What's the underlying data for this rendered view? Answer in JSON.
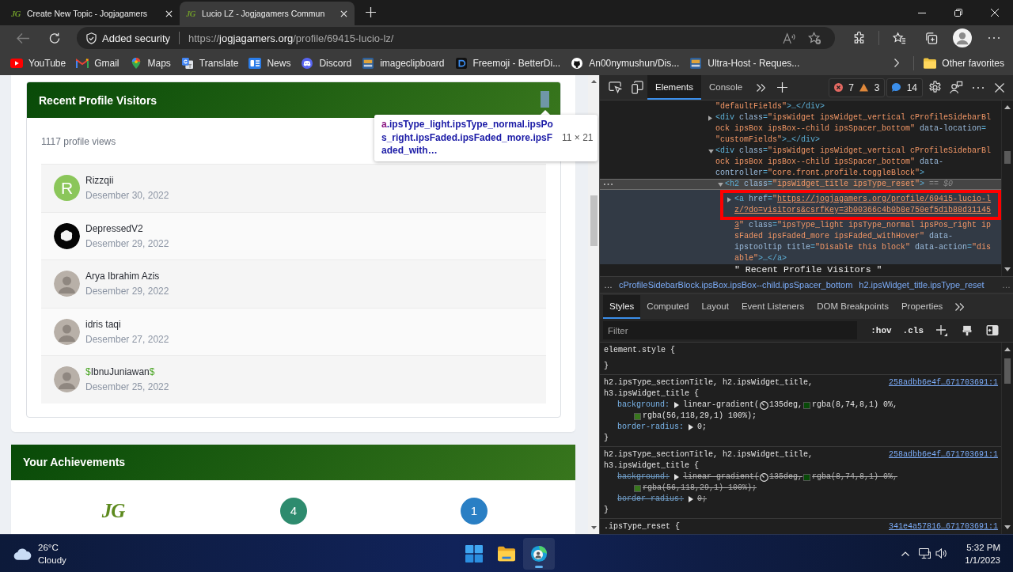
{
  "browser": {
    "tabs": [
      {
        "logo": "JG",
        "title": "Create New Topic - Jogjagamers",
        "selected": false
      },
      {
        "logo": "JG",
        "title": "Lucio LZ - Jogjagamers Commun",
        "selected": true
      }
    ],
    "back_button": {
      "disabled": true
    },
    "address_bar": {
      "security_label": "Added security",
      "url_scheme": "https://",
      "url_host": "jogjagamers.org",
      "url_path": "/profile/69415-lucio-lz/"
    },
    "bookmarks": [
      {
        "kind": "youtube",
        "label": "YouTube"
      },
      {
        "kind": "gmail",
        "label": "Gmail"
      },
      {
        "kind": "maps",
        "label": "Maps"
      },
      {
        "kind": "translate",
        "label": "Translate"
      },
      {
        "kind": "news",
        "label": "News"
      },
      {
        "kind": "discord",
        "label": "Discord"
      },
      {
        "kind": "picture",
        "label": "imageclipboard"
      },
      {
        "kind": "freemoji",
        "label": "Freemoji - BetterDi..."
      },
      {
        "kind": "github",
        "label": "An00nymushun/Dis..."
      },
      {
        "kind": "picture",
        "label": "Ultra-Host - Reques..."
      }
    ],
    "other_favorites": "Other favorites"
  },
  "page": {
    "visitors_widget": {
      "title": "Recent Profile Visitors",
      "view_count": "1117 profile views",
      "visitors": [
        {
          "kind": "letter",
          "initial": "R",
          "name": "Rizzqii",
          "date": "Desember 30, 2022"
        },
        {
          "kind": "graphic",
          "name": "DepressedV2",
          "date": "Desember 29, 2022"
        },
        {
          "kind": "photo",
          "name": "Arya Ibrahim Azis",
          "date": "Desember 29, 2022"
        },
        {
          "kind": "photo",
          "name": "idris taqi",
          "date": "Desember 27, 2022"
        },
        {
          "kind": "photo",
          "name_parts": [
            {
              "text": "$",
              "accent": true
            },
            {
              "text": "IbnuJuniawan",
              "accent": false
            },
            {
              "text": "$",
              "accent": true
            }
          ],
          "date": "Desember 25, 2022"
        }
      ]
    },
    "inspect_tooltip": {
      "element": "a",
      "classes": ".ipsType_light.ipsType_normal.ipsPos_right.ipsFaded.ipsFaded_more.ipsFaded_with…",
      "size": "11 × 21"
    },
    "achievements_widget": {
      "title": "Your Achievements",
      "items": [
        {
          "kind": "logo",
          "text": "JG"
        },
        {
          "kind": "badge",
          "text": "4",
          "color": "#2e8b6e"
        },
        {
          "kind": "badge",
          "text": "1",
          "color": "#2a7fc4"
        }
      ]
    }
  },
  "devtools": {
    "tabs": [
      {
        "label": "Elements",
        "selected": true
      },
      {
        "label": "Console",
        "selected": false
      }
    ],
    "issues": {
      "errors": "7",
      "warnings": "3",
      "messages": "14"
    },
    "dom_tree": [
      {
        "selected": false,
        "hovered": false,
        "lines": [
          {
            "tokens": [
              {
                "kind": "value",
                "text": "\"defaultFields\""
              },
              {
                "kind": "tag",
                "text": ">…</div>"
              }
            ]
          }
        ]
      },
      {
        "expanded": false,
        "selected": false,
        "hovered": false,
        "lines": [
          {
            "tokens": [
              {
                "kind": "tag",
                "text": "<div"
              },
              {
                "kind": "attr",
                "text": " class"
              },
              {
                "kind": "tag",
                "text": "="
              },
              {
                "kind": "value",
                "text": "\"ipsWidget ipsWidget_vertical cProfileSidebarBl"
              }
            ]
          },
          {
            "tokens": [
              {
                "kind": "value",
                "text": "ock ipsBox ipsBox--child ipsSpacer_bottom\""
              },
              {
                "kind": "attr",
                "text": " data-location"
              },
              {
                "kind": "tag",
                "text": "="
              }
            ]
          },
          {
            "tokens": [
              {
                "kind": "value",
                "text": "\"customFields\""
              },
              {
                "kind": "tag",
                "text": ">…</div>"
              }
            ]
          }
        ]
      },
      {
        "expanded": true,
        "selected": false,
        "hovered": false,
        "lines": [
          {
            "tokens": [
              {
                "kind": "tag",
                "text": "<div"
              },
              {
                "kind": "attr",
                "text": " class"
              },
              {
                "kind": "tag",
                "text": "="
              },
              {
                "kind": "value",
                "text": "\"ipsWidget ipsWidget_vertical cProfileSidebarBl"
              }
            ]
          },
          {
            "tokens": [
              {
                "kind": "value",
                "text": "ock ipsBox ipsBox--child ipsSpacer_bottom\""
              },
              {
                "kind": "attr",
                "text": " data-"
              }
            ]
          },
          {
            "tokens": [
              {
                "kind": "attr",
                "text": "controller"
              },
              {
                "kind": "tag",
                "text": "="
              },
              {
                "kind": "value",
                "text": "\"core.front.profile.toggleBlock\""
              },
              {
                "kind": "tag",
                "text": ">"
              }
            ]
          }
        ],
        "children": [
          {
            "expanded": true,
            "selected": true,
            "hovered": false,
            "console_ref": "== $0",
            "lines": [
              {
                "tokens": [
                  {
                    "kind": "tag",
                    "text": "<h2"
                  },
                  {
                    "kind": "attr",
                    "text": " class"
                  },
                  {
                    "kind": "tag",
                    "text": "="
                  },
                  {
                    "kind": "value",
                    "text": "\"ipsWidget_title ipsType_reset\""
                  },
                  {
                    "kind": "tag",
                    "text": ">"
                  }
                ]
              }
            ],
            "children": [
              {
                "expanded": false,
                "selected": false,
                "hovered": true,
                "outlined_lines": [
                  {
                    "tokens": [
                      {
                        "kind": "tag",
                        "text": "<a"
                      },
                      {
                        "kind": "attr",
                        "text": " href"
                      },
                      {
                        "kind": "tag",
                        "text": "="
                      },
                      {
                        "kind": "value",
                        "text": "\""
                      },
                      {
                        "kind": "link",
                        "text": "https://jogjagamers.org/profile/69415-lucio-l"
                      }
                    ]
                  },
                  {
                    "tokens": [
                      {
                        "kind": "link",
                        "text": "z/?do=visitors&csrfKey=3b00366c4b0b8e750ef5d1b88d31145"
                      }
                    ]
                  }
                ],
                "lines": [
                  {
                    "tokens": [
                      {
                        "kind": "link",
                        "text": "3"
                      },
                      {
                        "kind": "value",
                        "text": "\""
                      },
                      {
                        "kind": "attr",
                        "text": " class"
                      },
                      {
                        "kind": "tag",
                        "text": "="
                      },
                      {
                        "kind": "value",
                        "text": "\"ipsType_light ipsType_normal ipsPos_right ip"
                      }
                    ]
                  },
                  {
                    "tokens": [
                      {
                        "kind": "value",
                        "text": "sFaded ipsFaded_more ipsFaded_withHover\""
                      },
                      {
                        "kind": "attr",
                        "text": " data-"
                      }
                    ]
                  },
                  {
                    "tokens": [
                      {
                        "kind": "attr",
                        "text": "ipstooltip title"
                      },
                      {
                        "kind": "tag",
                        "text": "="
                      },
                      {
                        "kind": "value",
                        "text": "\"Disable this block\""
                      },
                      {
                        "kind": "attr",
                        "text": " data-action"
                      },
                      {
                        "kind": "tag",
                        "text": "="
                      },
                      {
                        "kind": "value",
                        "text": "\"dis"
                      }
                    ]
                  },
                  {
                    "tokens": [
                      {
                        "kind": "value",
                        "text": "able\""
                      },
                      {
                        "kind": "tag",
                        "text": ">…</a>"
                      }
                    ]
                  }
                ]
              },
              {
                "selected": false,
                "hovered": false,
                "lines": [
                  {
                    "tokens": [
                      {
                        "kind": "text",
                        "text": "\" Recent Profile Visitors \""
                      }
                    ]
                  }
                ]
              }
            ]
          }
        ]
      }
    ],
    "breadcrumbs": {
      "scroll_left": "…",
      "items": [
        "cProfileSidebarBlock.ipsBox.ipsBox--child.ipsSpacer_bottom",
        "h2.ipsWidget_title.ipsType_reset"
      ],
      "scroll_right": "…"
    },
    "pane_tabs": [
      {
        "label": "Styles",
        "selected": true
      },
      {
        "label": "Computed",
        "selected": false
      },
      {
        "label": "Layout",
        "selected": false
      },
      {
        "label": "Event Listeners",
        "selected": false
      },
      {
        "label": "DOM Breakpoints",
        "selected": false
      },
      {
        "label": "Properties",
        "selected": false
      }
    ],
    "filter": {
      "placeholder": "Filter"
    },
    "filter_toggles": [
      ":hov",
      ".cls"
    ],
    "style_rules": [
      {
        "selector_lines": [
          "element.style {"
        ],
        "close": "}"
      },
      {
        "selector_lines": [
          "h2.ipsType_sectionTitle, h2.ipsWidget_title,",
          "h3.ipsWidget_title {"
        ],
        "source": "258adbb6e4f…671703691:1",
        "declarations": [
          {
            "property": "background:",
            "expandable": true,
            "overridden": false,
            "value": [
              {
                "kind": "text",
                "text": "linear-gradient("
              },
              {
                "kind": "angle"
              },
              {
                "kind": "text",
                "text": "135deg,"
              },
              {
                "kind": "swatch",
                "color": "#084a08"
              },
              {
                "kind": "text",
                "text": "rgba(8,74,8,1) 0%,"
              },
              {
                "kind": "break"
              },
              {
                "kind": "swatch",
                "color": "#38761d"
              },
              {
                "kind": "text",
                "text": "rgba(56,118,29,1) 100%);"
              }
            ]
          },
          {
            "property": "border-radius:",
            "expandable": true,
            "overridden": false,
            "value": [
              {
                "kind": "text",
                "text": "0;"
              }
            ]
          }
        ],
        "close": "}"
      },
      {
        "selector_lines": [
          "h2.ipsType_sectionTitle, h2.ipsWidget_title,",
          "h3.ipsWidget_title {"
        ],
        "source": "258adbb6e4f…671703691:1",
        "declarations": [
          {
            "property": "background:",
            "expandable": true,
            "overridden": true,
            "value": [
              {
                "kind": "text",
                "text": "linear-gradient("
              },
              {
                "kind": "angle"
              },
              {
                "kind": "text",
                "text": "135deg,"
              },
              {
                "kind": "swatch",
                "color": "#084a08"
              },
              {
                "kind": "text",
                "text": "rgba(8,74,8,1) 0%,"
              },
              {
                "kind": "break"
              },
              {
                "kind": "swatch",
                "color": "#38761d"
              },
              {
                "kind": "text",
                "text": "rgba(56,118,29,1) 100%);"
              }
            ]
          },
          {
            "property": "border-radius:",
            "expandable": true,
            "overridden": true,
            "value": [
              {
                "kind": "text",
                "text": "0;"
              }
            ]
          }
        ],
        "close": "}"
      },
      {
        "selector_lines": [
          ".ipsType_reset {"
        ],
        "source": "341e4a57816…671703691:1"
      }
    ]
  },
  "taskbar": {
    "weather": {
      "temperature": "26°C",
      "condition": "Cloudy"
    },
    "apps": [
      {
        "kind": "start",
        "active": false
      },
      {
        "kind": "files",
        "active": false
      },
      {
        "kind": "browser",
        "active": true
      }
    ],
    "clock": {
      "time": "5:32 PM",
      "date": "1/1/2023"
    }
  }
}
